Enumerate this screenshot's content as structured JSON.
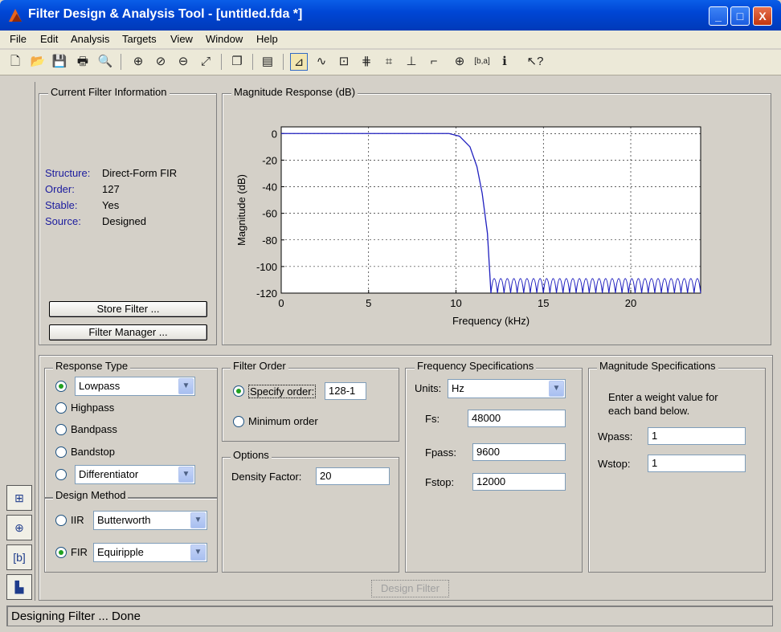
{
  "window": {
    "title": "Filter Design & Analysis Tool - [untitled.fda *]",
    "controls": {
      "minimize": "_",
      "maximize": "□",
      "close": "X"
    }
  },
  "menu": [
    "File",
    "Edit",
    "Analysis",
    "Targets",
    "View",
    "Window",
    "Help"
  ],
  "toolbar": {
    "buttons": [
      {
        "name": "new-icon",
        "glyph": "🗋"
      },
      {
        "name": "open-icon",
        "glyph": "📂"
      },
      {
        "name": "save-icon",
        "glyph": "💾"
      },
      {
        "name": "print-icon",
        "glyph": "🖶"
      },
      {
        "name": "print-preview-icon",
        "glyph": "🔍"
      },
      {
        "name": "zoom-in-icon",
        "glyph": "⊕"
      },
      {
        "name": "zoom-x-icon",
        "glyph": "⊘"
      },
      {
        "name": "zoom-y-icon",
        "glyph": "⊖"
      },
      {
        "name": "full-view-icon",
        "glyph": "⤢"
      },
      {
        "name": "new-figure-icon",
        "glyph": "❐"
      },
      {
        "name": "filter-specs-icon",
        "glyph": "▤"
      },
      {
        "name": "magnitude-response-icon",
        "glyph": "⊿"
      },
      {
        "name": "phase-response-icon",
        "glyph": "∿"
      },
      {
        "name": "mag-phase-icon",
        "glyph": "⊡"
      },
      {
        "name": "group-delay-icon",
        "glyph": "⋕"
      },
      {
        "name": "phase-delay-icon",
        "glyph": "⌗"
      },
      {
        "name": "impulse-response-icon",
        "glyph": "⊥"
      },
      {
        "name": "step-response-icon",
        "glyph": "⌐"
      },
      {
        "name": "pole-zero-icon",
        "glyph": "⊕"
      },
      {
        "name": "filter-coefficients-icon",
        "glyph": "[b,a]"
      },
      {
        "name": "filter-info-icon",
        "glyph": "ℹ"
      },
      {
        "name": "whats-this-icon",
        "glyph": "↖?"
      }
    ]
  },
  "current_filter": {
    "title": "Current Filter Information",
    "fields": [
      {
        "label": "Structure:",
        "value": "Direct-Form FIR"
      },
      {
        "label": "Order:",
        "value": "127"
      },
      {
        "label": "Stable:",
        "value": "Yes"
      },
      {
        "label": "Source:",
        "value": "Designed"
      }
    ],
    "store_button": "Store Filter ...",
    "manager_button": "Filter Manager ..."
  },
  "chart_data": {
    "type": "line",
    "title": "Magnitude Response (dB)",
    "xlabel": "Frequency (kHz)",
    "ylabel": "Magnitude (dB)",
    "xlim": [
      0,
      24
    ],
    "ylim": [
      -120,
      5
    ],
    "xticks": [
      "0",
      "5",
      "10",
      "15",
      "20"
    ],
    "yticks": [
      "0",
      "-20",
      "-40",
      "-60",
      "-80",
      "-100",
      "-120"
    ],
    "grid": true,
    "series": [
      {
        "color": "#1f1fbf",
        "passband_end_khz": 9.6,
        "stopband_start_khz": 12,
        "stopband_floor_db": -103,
        "x": [
          0,
          9.6,
          10.2,
          10.8,
          11.2,
          11.5,
          11.8,
          12.0
        ],
        "y": [
          0,
          0,
          -2,
          -10,
          -25,
          -45,
          -75,
          -120
        ]
      }
    ]
  },
  "response_type": {
    "title": "Response Type",
    "options": [
      {
        "label": "Lowpass",
        "selected": true,
        "dropdown": true
      },
      {
        "label": "Highpass",
        "selected": false
      },
      {
        "label": "Bandpass",
        "selected": false
      },
      {
        "label": "Bandstop",
        "selected": false
      },
      {
        "label": "Differentiator",
        "selected": false,
        "dropdown": true
      }
    ]
  },
  "design_method": {
    "title": "Design Method",
    "iir_label": "IIR",
    "iir_value": "Butterworth",
    "fir_label": "FIR",
    "fir_value": "Equiripple",
    "selected": "FIR"
  },
  "filter_order": {
    "title": "Filter Order",
    "specify_label": "Specify order:",
    "specify_value": "128-1",
    "minimum_label": "Minimum order",
    "selected": "specify"
  },
  "options": {
    "title": "Options",
    "density_label": "Density Factor:",
    "density_value": "20"
  },
  "freq_specs": {
    "title": "Frequency Specifications",
    "units_label": "Units:",
    "units_value": "Hz",
    "fs_label": "Fs:",
    "fs_value": "48000",
    "fpass_label": "Fpass:",
    "fpass_value": "9600",
    "fstop_label": "Fstop:",
    "fstop_value": "12000"
  },
  "mag_specs": {
    "title": "Magnitude Specifications",
    "note_line1": "Enter a weight value for",
    "note_line2": "each band below.",
    "wpass_label": "Wpass:",
    "wpass_value": "1",
    "wstop_label": "Wstop:",
    "wstop_value": "1"
  },
  "design_button": "Design Filter",
  "status": "Designing Filter ... Done"
}
